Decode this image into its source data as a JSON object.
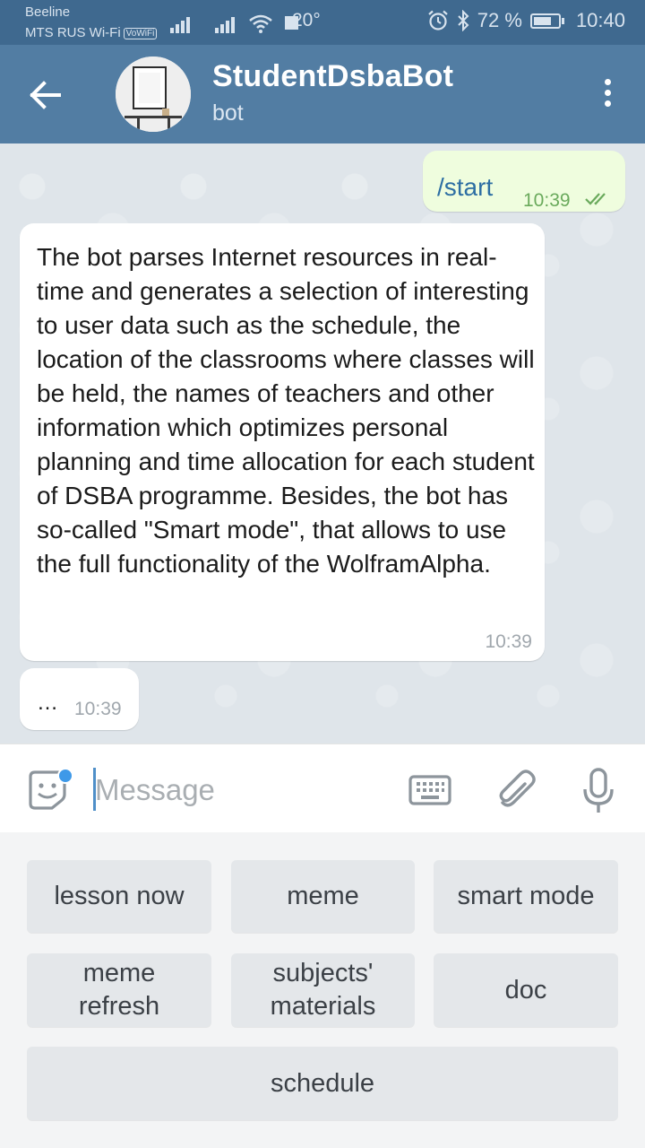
{
  "status_bar": {
    "carrier_1": "Beeline",
    "carrier_2": "MTS RUS Wi-Fi",
    "volte_badge": "VoWiFi",
    "temperature": "20°",
    "battery_percent": "72 %",
    "battery_level": 0.72,
    "time": "10:40"
  },
  "header": {
    "title": "StudentDsbaBot",
    "subtitle": "bot",
    "back_icon": "arrow-left-icon",
    "menu_icon": "more-vertical-icon"
  },
  "messages": [
    {
      "direction": "outgoing",
      "text": "/start",
      "time": "10:39",
      "status_icon": "double-check-icon"
    },
    {
      "direction": "incoming",
      "text": "The bot parses Internet resources in real-time and generates a selection of interesting to user data such as the schedule, the location of the classrooms where classes will be held, the names of teachers and other information which optimizes personal planning and time allocation for each student of DSBA programme. Besides, the bot has so-called \"Smart mode\", that allows to use the full functionality of the WolframAlpha.",
      "time": "10:39"
    },
    {
      "direction": "incoming",
      "text": "…",
      "time": "10:39"
    }
  ],
  "compose": {
    "placeholder": "Message",
    "value": "",
    "emoji_icon": "sticker-icon",
    "keyboard_icon": "keyboard-icon",
    "attach_icon": "paperclip-icon",
    "mic_icon": "microphone-icon"
  },
  "keyboard_buttons": [
    [
      "lesson now",
      "meme",
      "smart mode"
    ],
    [
      "meme\nrefresh",
      "subjects'\nmaterials",
      "doc"
    ],
    [
      "schedule"
    ]
  ],
  "colors": {
    "header": "#527da3",
    "status_bar": "#3f698f",
    "outgoing_bubble": "#effdde",
    "incoming_bubble": "#ffffff",
    "accent": "#3e99e8"
  }
}
